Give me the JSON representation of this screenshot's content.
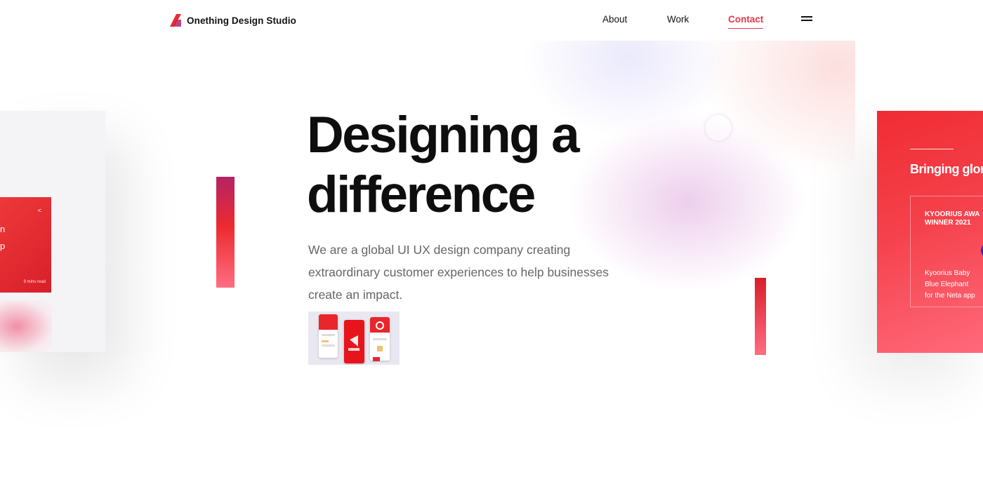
{
  "header": {
    "logo_text": "Onething Design Studio",
    "nav": [
      {
        "label": "About"
      },
      {
        "label": "Work"
      },
      {
        "label": "Contact",
        "active": true
      }
    ]
  },
  "hero": {
    "title_line1": "Designing a",
    "title_line2": "difference",
    "description": "We are a global UI UX design company creating extraordinary customer experiences to help businesses create an impact."
  },
  "left_card": {
    "text_line1": "n",
    "text_line2": "p",
    "read_time": "9 mins read"
  },
  "right_card": {
    "heading": "Bringing glor",
    "award_line1": "KYOORIUS AWA",
    "award_line2": "WINNER 2021",
    "project_line1": "Kyoorius Baby",
    "project_line2": "Blue Elephant",
    "project_line3": "for the Neta app"
  },
  "colors": {
    "accent": "#e8364a",
    "brand_red": "#f02c33",
    "text_dark": "#0e0e0e",
    "text_muted": "#666666"
  },
  "icons": [
    "logo-mark-icon",
    "menu-icon",
    "share-icon"
  ]
}
